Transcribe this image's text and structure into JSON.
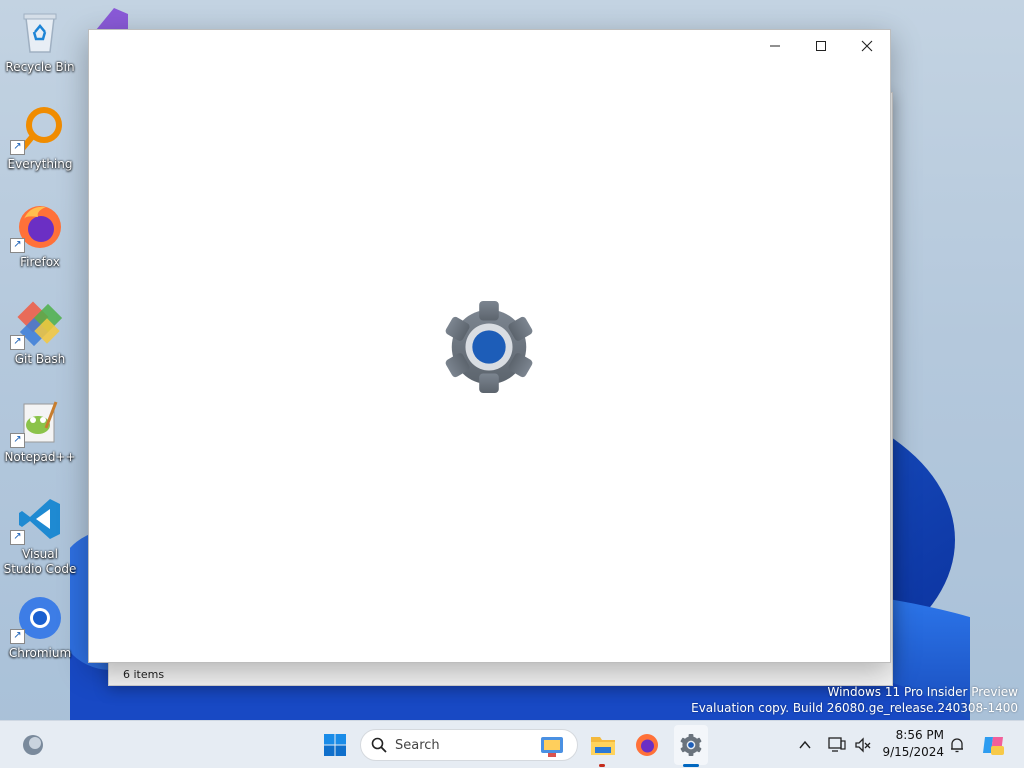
{
  "desktop": {
    "icons": [
      {
        "label": "Recycle Bin"
      },
      {
        "label": "Everything"
      },
      {
        "label": "Firefox"
      },
      {
        "label": "Git Bash"
      },
      {
        "label": "Notepad++"
      },
      {
        "label": "Visual Studio Code"
      },
      {
        "label": "Chromium"
      }
    ]
  },
  "explorer_window": {
    "status": "6 items"
  },
  "settings_window": {
    "icon": "gear-icon"
  },
  "watermark": {
    "line1": "Windows 11 Pro Insider Preview",
    "line2": "Evaluation copy. Build 26080.ge_release.240308-1400"
  },
  "taskbar": {
    "search_label": "Search",
    "time": "8:56 PM",
    "date": "9/15/2024",
    "accent": "#0067c0"
  }
}
